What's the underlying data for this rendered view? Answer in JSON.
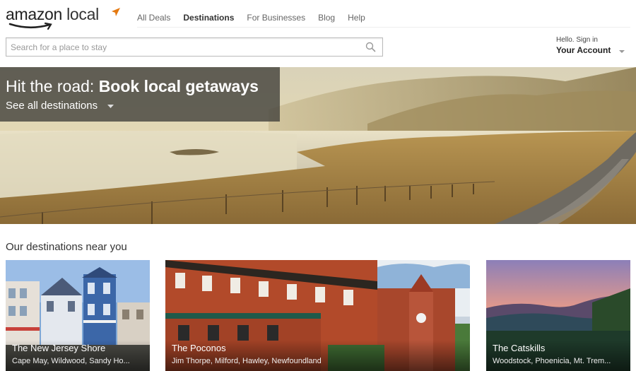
{
  "logo": {
    "word1": "amazon",
    "word2": "local"
  },
  "nav": {
    "items": [
      {
        "label": "All Deals"
      },
      {
        "label": "Destinations"
      },
      {
        "label": "For Businesses"
      },
      {
        "label": "Blog"
      },
      {
        "label": "Help"
      }
    ]
  },
  "search": {
    "placeholder": "Search for a place to stay"
  },
  "account": {
    "hello": "Hello. Sign in",
    "label": "Your Account"
  },
  "hero": {
    "title_plain": "Hit the road: ",
    "title_bold": "Book local getaways",
    "link": "See all destinations"
  },
  "section": {
    "title": "Our destinations near you"
  },
  "cards": [
    {
      "title": "The New Jersey Shore",
      "subtitle": "Cape May, Wildwood, Sandy Ho..."
    },
    {
      "title": "The Poconos",
      "subtitle": "Jim Thorpe, Milford, Hawley, Newfoundland"
    },
    {
      "title": "The Catskills",
      "subtitle": "Woodstock, Phoenicia, Mt. Trem..."
    }
  ],
  "colors": {
    "accent": "#e47911",
    "overlay": "#46443e"
  }
}
